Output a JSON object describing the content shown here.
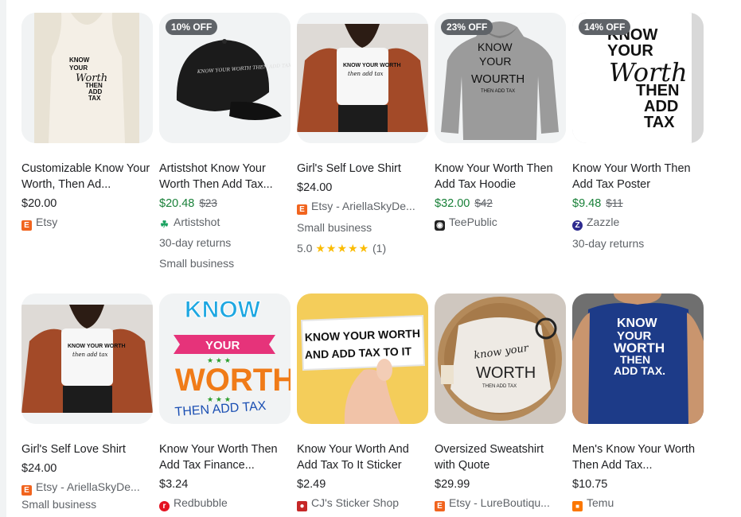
{
  "products": [
    {
      "title": "Customizable Know Your Worth, Then Ad...",
      "price": "$20.00",
      "old_price": "",
      "badge": "",
      "merchant": "Etsy",
      "merchant_icon": "etsy-icon",
      "extras": []
    },
    {
      "title": "Artistshot Know Your Worth Then Add Tax...",
      "price": "$20.48",
      "old_price": "$23",
      "badge": "10% OFF",
      "merchant": "Artistshot",
      "merchant_icon": "artistshot-icon",
      "extras": [
        "30-day returns",
        "Small business"
      ]
    },
    {
      "title": "Girl's Self Love Shirt",
      "price": "$24.00",
      "old_price": "",
      "badge": "",
      "merchant": "Etsy - AriellaSkyDe...",
      "merchant_icon": "etsy-icon",
      "extras": [
        "Small business"
      ],
      "rating": "5.0",
      "reviews": "(1)"
    },
    {
      "title": "Know Your Worth Then Add Tax Hoodie",
      "price": "$32.00",
      "old_price": "$42",
      "badge": "23% OFF",
      "merchant": "TeePublic",
      "merchant_icon": "teepublic-icon",
      "extras": []
    },
    {
      "title": "Know Your Worth Then Add Tax Poster",
      "price": "$9.48",
      "old_price": "$11",
      "badge": "14% OFF",
      "merchant": "Zazzle",
      "merchant_icon": "zazzle-icon",
      "extras": [
        "30-day returns"
      ]
    },
    {
      "title": "Girl's Self Love Shirt",
      "price": "$24.00",
      "old_price": "",
      "badge": "",
      "merchant": "Etsy - AriellaSkyDe...",
      "merchant_icon": "etsy-icon",
      "extras": [
        "Small business"
      ]
    },
    {
      "title": "Know Your Worth Then Add Tax Finance...",
      "price": "$3.24",
      "old_price": "",
      "badge": "",
      "merchant": "Redbubble",
      "merchant_icon": "redbubble-icon",
      "extras": []
    },
    {
      "title": "Know Your Worth And Add Tax To It Sticker",
      "price": "$2.49",
      "old_price": "",
      "badge": "",
      "merchant": "CJ's Sticker Shop",
      "merchant_icon": "cj-sticker-icon",
      "extras": []
    },
    {
      "title": "Oversized Sweatshirt with Quote",
      "price": "$29.99",
      "old_price": "",
      "badge": "",
      "merchant": "Etsy - LureBoutiqu...",
      "merchant_icon": "etsy-icon",
      "extras": []
    },
    {
      "title": "Men's Know Your Worth Then Add Tax...",
      "price": "$10.75",
      "old_price": "",
      "badge": "",
      "merchant": "Temu",
      "merchant_icon": "temu-icon",
      "extras": []
    }
  ],
  "image_text": {
    "tank": [
      "KNOW",
      "YOUR",
      "Worth",
      "THEN",
      "ADD",
      "TAX"
    ],
    "cap": "KNOW YOUR WORTH THEN ADD TAX",
    "shirt_line1": "KNOW YOUR WORTH",
    "shirt_line2": "then add tax",
    "hoodie": [
      "KNOW",
      "YOUR",
      "WOURTH",
      "THEN ADD TAX"
    ],
    "poster": [
      "KNOW",
      "YOUR",
      "Worth",
      "THEN",
      "ADD",
      "TAX"
    ],
    "sticker1": [
      "KNOW",
      "YOUR",
      "WORTH",
      "THEN ADD TAX"
    ],
    "sticker2": [
      "KNOW YOUR WORTH",
      "AND ADD TAX TO IT"
    ],
    "sweatshirt": [
      "know your",
      "WORTH",
      "THEN ADD TAX"
    ],
    "tshirt": [
      "KNOW",
      "YOUR",
      "WORTH",
      "THEN",
      "ADD TAX."
    ]
  },
  "colors": {
    "sale_price": "#188038",
    "badge_bg": "#5f6368",
    "star": "#fbbc04",
    "etsy": "#f1641e"
  }
}
